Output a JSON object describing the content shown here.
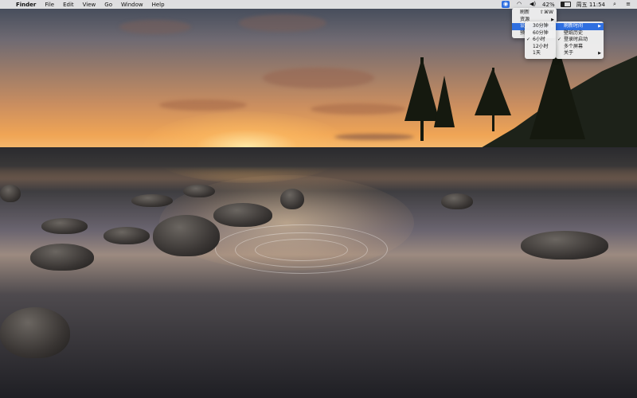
{
  "menubar": {
    "apple_icon": "apple-logo",
    "items": [
      "Finder",
      "File",
      "Edit",
      "View",
      "Go",
      "Window",
      "Help"
    ],
    "status": {
      "app_icon": "wallpaper-app-icon",
      "wifi_icon": "wifi-icon",
      "volume_icon": "speaker-icon",
      "battery_percent": "42%",
      "battery_level": 0.42,
      "clock": "周五 11:54",
      "search_icon": "magnifier-icon",
      "list_icon": "list-icon"
    }
  },
  "main_menu": {
    "items": [
      {
        "label": "刷新",
        "shortcut": "⇧⌘W"
      },
      {
        "label": "资源",
        "submenu": true
      },
      {
        "label": "设置",
        "submenu": true,
        "highlighted": true
      },
      {
        "label": "预"
      }
    ]
  },
  "settings_menu": {
    "items": [
      {
        "label": "刷新时间",
        "submenu": true,
        "highlighted": true
      },
      {
        "label": "壁纸历史"
      },
      {
        "label": "登录时启动",
        "checked": true
      },
      {
        "label": "多个屏幕"
      },
      {
        "label": "关于"
      }
    ]
  },
  "interval_menu": {
    "items": [
      {
        "label": "30分钟"
      },
      {
        "label": "60分钟"
      },
      {
        "label": "6小时",
        "checked": true
      },
      {
        "label": "12小时"
      },
      {
        "label": "1天"
      }
    ]
  },
  "glyphs": {
    "apple": "",
    "check": "✓",
    "arrow": "▶",
    "wifi": "◠",
    "speaker": "◀)",
    "search": "⌕",
    "list": "≡"
  }
}
